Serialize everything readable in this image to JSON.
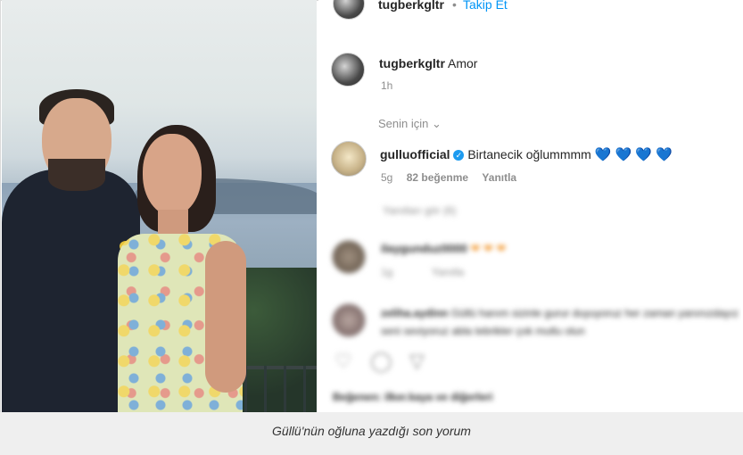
{
  "post": {
    "header_user": "tugberkgltr",
    "follow_label": "Takip Et",
    "caption_user": "tugberkgltr",
    "caption_text": "Amor",
    "caption_time": "1h",
    "sort_label": "Senin için",
    "comment": {
      "user": "gulluofficial",
      "text": "Birtanecik oğlummmm",
      "hearts": "💙 💙 💙 💙",
      "time": "5g",
      "likes": "82 beğenme",
      "reply": "Yanıtla"
    },
    "blurred": {
      "view_replies": "Yanıtları gör (6)",
      "comment2_user": "ilaygunduz0000",
      "comment2_time": "1g",
      "comment2_reply": "Yanıtla",
      "comment3_user": "zeliha.aydinn",
      "comment3_text": "Güllü hanım sizinle gurur duyuyoruz her zaman yanınızdayız",
      "comment3_text2": "seni seviyoruz abla tebrikler çok mutlu olun",
      "likes_line": "Beğenen: ilker.kaya ve diğerleri"
    }
  },
  "caption": "Güllü'nün oğluna yazdığı son yorum",
  "colors": {
    "accent": "#3b82d6",
    "verified": "#1d9bf0",
    "text": "#262626",
    "muted": "#8e8e8e"
  }
}
